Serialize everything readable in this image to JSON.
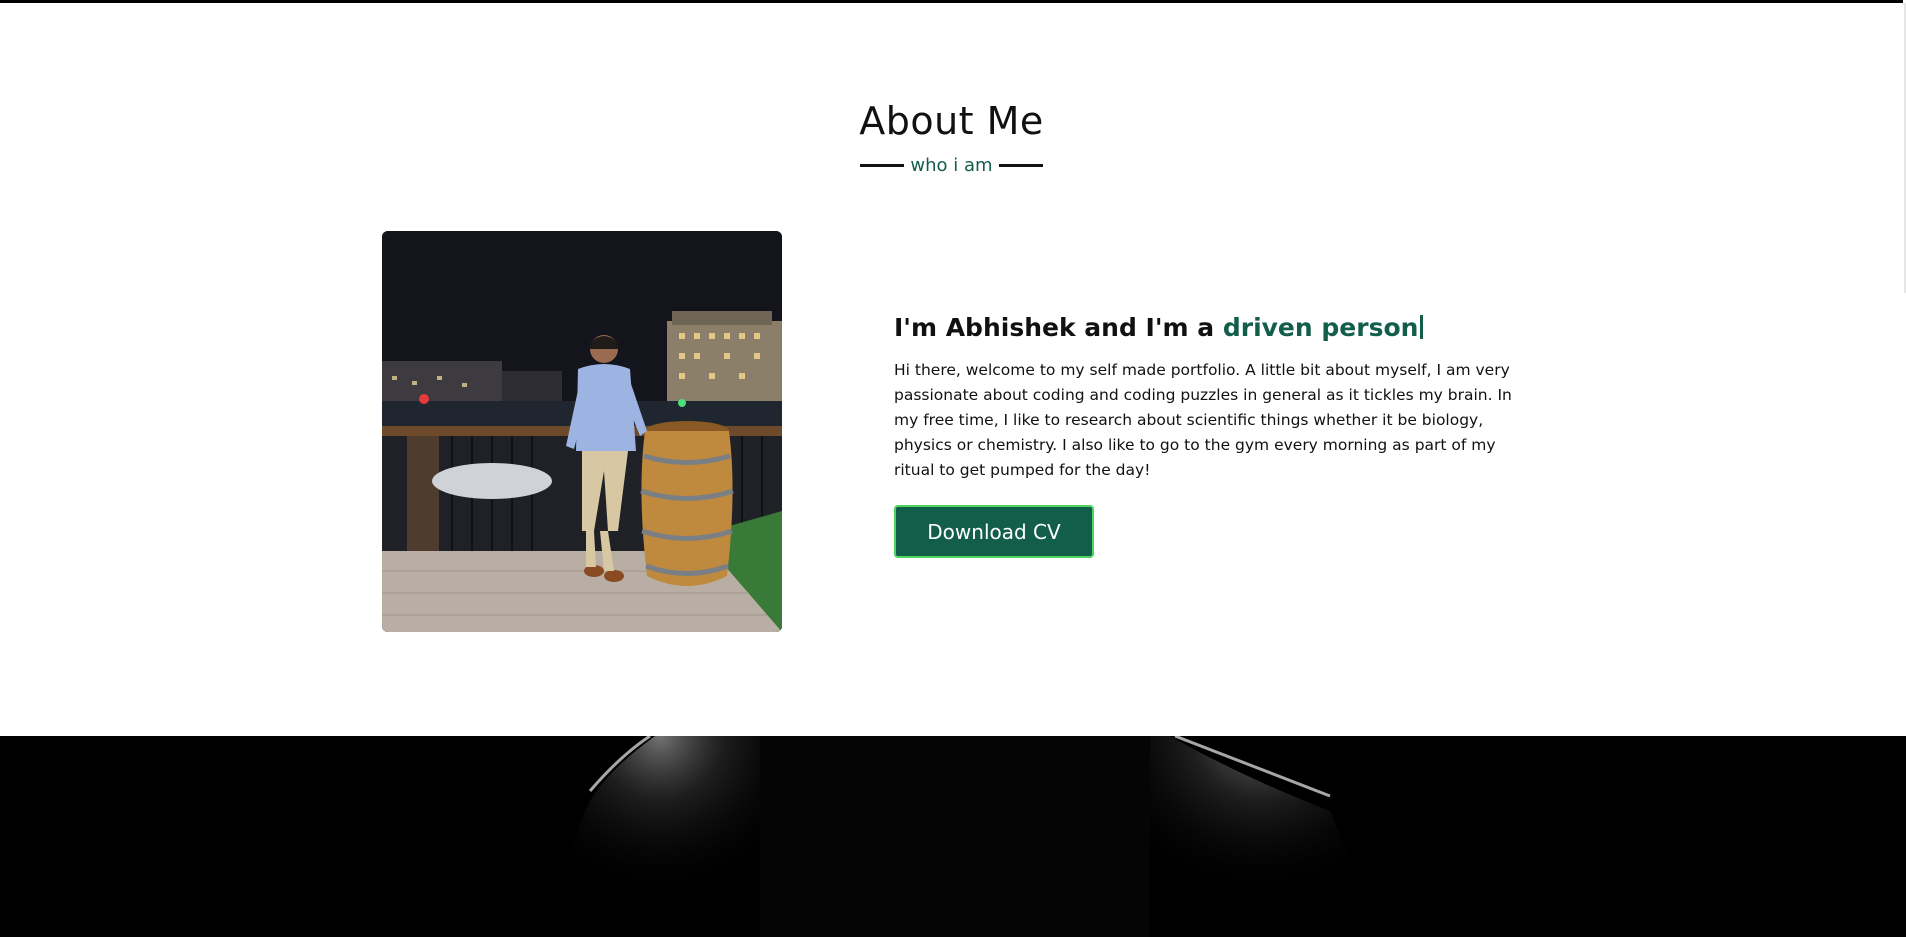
{
  "about": {
    "title": "About Me",
    "subtitle": "who i am",
    "photo_alt": "Abhishek standing next to a wine barrel at a marina at night",
    "intro_prefix": "I'm Abhishek and I'm a ",
    "intro_accent": "driven person",
    "bio": "Hi there, welcome to my self made portfolio. A little bit about myself, I am very passionate about coding and coding puzzles in general as it tickles my brain. In my free time, I like to research about scientific things whether it be biology, physics or chemistry. I also like to go to the gym every morning as part of my ritual to get pumped for the day!",
    "download_label": "Download CV"
  },
  "colors": {
    "accent": "#135e4b",
    "button_border": "#4ed45f",
    "text": "#111111",
    "dark_section": "#000000"
  }
}
